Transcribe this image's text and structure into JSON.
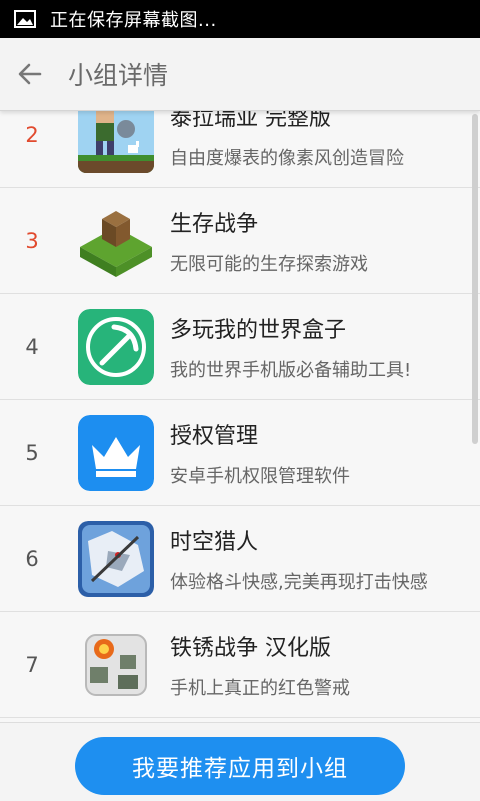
{
  "status_bar": {
    "text": "正在保存屏幕截图..."
  },
  "header": {
    "title": "小组详情"
  },
  "apps": [
    {
      "rank": "2",
      "name": "泰拉瑞亚 完整版",
      "desc": "自由度爆表的像素风创造冒险",
      "icon": "terraria-character-icon"
    },
    {
      "rank": "3",
      "name": "生存战争",
      "desc": "无限可能的生存探索游戏",
      "icon": "grass-block-icon"
    },
    {
      "rank": "4",
      "name": "多玩我的世界盒子",
      "desc": "我的世界手机版必备辅助工具!",
      "icon": "pickaxe-icon"
    },
    {
      "rank": "5",
      "name": "授权管理",
      "desc": "安卓手机权限管理软件",
      "icon": "crown-icon"
    },
    {
      "rank": "6",
      "name": "时空猎人",
      "desc": "体验格斗快感,完美再现打击快感",
      "icon": "wolf-warrior-icon"
    },
    {
      "rank": "7",
      "name": "铁锈战争 汉化版",
      "desc": "手机上真正的红色警戒",
      "icon": "rusted-warfare-icon"
    }
  ],
  "footer": {
    "button_label": "我要推荐应用到小组"
  },
  "colors": {
    "accent": "#1e8ff0",
    "rank_top": "#e14a2e"
  }
}
